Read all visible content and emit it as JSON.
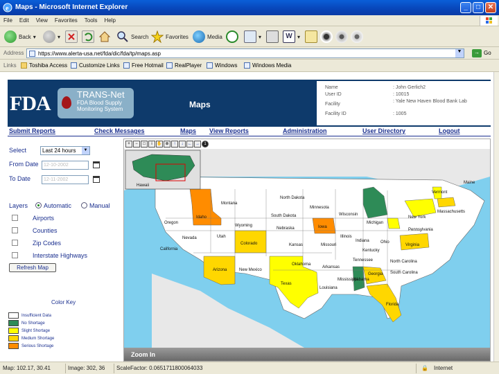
{
  "window": {
    "title": "Maps - Microsoft Internet Explorer",
    "min": "_",
    "max": "□",
    "close": "✕"
  },
  "menu": [
    "File",
    "Edit",
    "View",
    "Favorites",
    "Tools",
    "Help"
  ],
  "toolbar": {
    "back_label": "Back",
    "search_label": "Search",
    "favorites_label": "Favorites",
    "media_label": "Media",
    "icons": [
      "back-icon",
      "forward-icon",
      "stop-icon",
      "refresh-icon",
      "home-icon",
      "search-icon",
      "favorites-icon",
      "media-icon",
      "history-icon",
      "mail-icon",
      "print-icon",
      "word-icon",
      "discuss-icon",
      "messenger-icon",
      "gear-icon",
      "settings-icon"
    ]
  },
  "address": {
    "label": "Address",
    "url": "https://www.alerta-usa.net/fda/dic/fda/tp/maps.asp",
    "go": "→",
    "go_label": "Go"
  },
  "links": {
    "label": "Links",
    "items": [
      "Toshiba Access",
      "Customize Links",
      "Free Hotmail",
      "RealPlayer",
      "Windows",
      "Windows Media"
    ]
  },
  "banner": {
    "logo": "FDA",
    "app_name": "TRANS-Net",
    "app_sub": "FDA Blood Supply Monitoring System",
    "title": "Maps",
    "info": [
      {
        "k": "Name",
        "v": ": John Gerlich2"
      },
      {
        "k": "User ID",
        "v": ": 10015"
      },
      {
        "k": "Facility",
        "v": ": Yale New Haven Blood Bank Lab"
      },
      {
        "k": "Facility ID",
        "v": ": 1005"
      }
    ]
  },
  "nav": [
    "Submit Reports",
    "Check Messages",
    "Maps",
    "View Reports",
    "Administration",
    "User Directory",
    "Logout"
  ],
  "controls": {
    "select_label": "Select",
    "select_value": "Last 24 hours",
    "from_label": "From Date",
    "from_value": "12-10-2002",
    "to_label": "To Date",
    "to_value": "12-11-2002",
    "layers_label": "Layers",
    "automatic": "Automatic",
    "manual": "Manual",
    "layers": [
      "Airports",
      "Counties",
      "Zip Codes",
      "Interstate Highways"
    ],
    "refresh": "Refresh Map"
  },
  "legend": {
    "title": "Color Key",
    "items": [
      {
        "label": "Insufficient Data",
        "color": "#ffffff"
      },
      {
        "label": "No Shortage",
        "color": "#2e8b57"
      },
      {
        "label": "Slight Shortage",
        "color": "#ffff00"
      },
      {
        "label": "Medium Shortage",
        "color": "#ffd700"
      },
      {
        "label": "Serious Shortage",
        "color": "#ff8c00"
      }
    ]
  },
  "map": {
    "inset_label": "Hawaii",
    "zoom_label": "Zoom In",
    "states": [
      "Montana",
      "North Dakota",
      "Minnesota",
      "Wisconsin",
      "Michigan",
      "Vermont",
      "Massachusetts",
      "New York",
      "Pennsylvania",
      "Oregon",
      "Idaho",
      "Wyoming",
      "South Dakota",
      "Iowa",
      "Illinois",
      "Indiana",
      "Ohio",
      "Virginia",
      "Nevada",
      "Utah",
      "Colorado",
      "Nebraska",
      "Kansas",
      "Missouri",
      "Kentucky",
      "California",
      "Arizona",
      "New Mexico",
      "Oklahoma",
      "Arkansas",
      "Tennessee",
      "North Carolina",
      "South Carolina",
      "Texas",
      "Louisiana",
      "Mississippi",
      "Alabama",
      "Georgia",
      "Florida",
      "Maine"
    ]
  },
  "status": {
    "map": "Map: 102.17, 30.41",
    "image": "Image: 302, 36",
    "scale": "ScaleFactor: 0.0651711800064033",
    "zone": "Internet"
  }
}
